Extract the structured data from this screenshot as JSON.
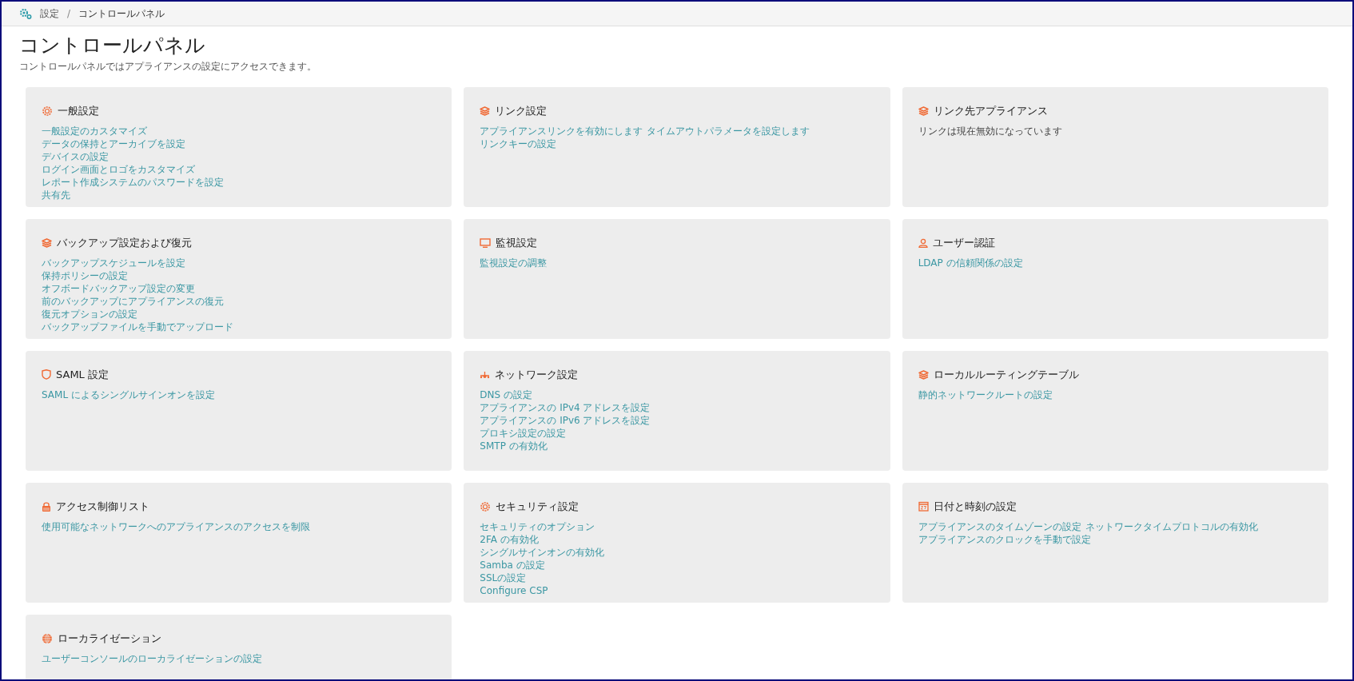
{
  "breadcrumb": [
    {
      "label": "設定",
      "kind": "link"
    },
    {
      "label": "/",
      "kind": "separator"
    },
    {
      "label": "コントロールパネル",
      "kind": "current"
    }
  ],
  "page": {
    "title": "コントロールパネル",
    "subtitle": "コントロールパネルではアプライアンスの設定にアクセスできます。"
  },
  "cards": [
    {
      "title": "一般設定",
      "items": [
        {
          "kind": "link",
          "label": "一般設定のカスタマイズ"
        },
        {
          "kind": "link",
          "label": "データの保持とアーカイブを設定"
        },
        {
          "kind": "link",
          "label": "デバイスの設定"
        },
        {
          "kind": "link",
          "label": "ログイン画面とロゴをカスタマイズ"
        },
        {
          "kind": "link",
          "label": "レポート作成システムのパスワードを設定"
        },
        {
          "kind": "link",
          "label": "共有先"
        }
      ]
    },
    {
      "title": "リンク設定",
      "items": [
        {
          "kind": "inline_link",
          "label": "アプライアンスリンクを有効にします"
        },
        {
          "kind": "inline_link",
          "label": "タイムアウトパラメータを設定します"
        },
        {
          "kind": "inline_link",
          "label": "リンクキーの設定"
        }
      ]
    },
    {
      "title": "リンク先アプライアンス",
      "items": [
        {
          "kind": "text",
          "label": "リンクは現在無効になっています"
        }
      ]
    },
    {
      "title": "バックアップ設定および復元",
      "items": [
        {
          "kind": "link",
          "label": "バックアップスケジュールを設定"
        },
        {
          "kind": "link",
          "label": "保持ポリシーの設定"
        },
        {
          "kind": "link",
          "label": "オフボードバックアップ設定の変更"
        },
        {
          "kind": "link",
          "label": "前のバックアップにアプライアンスの復元"
        },
        {
          "kind": "link",
          "label": "復元オプションの設定"
        },
        {
          "kind": "link",
          "label": "バックアップファイルを手動でアップロード"
        }
      ]
    },
    {
      "title": "監視設定",
      "items": [
        {
          "kind": "link",
          "label": "監視設定の調整"
        }
      ]
    },
    {
      "title": "ユーザー認証",
      "items": [
        {
          "kind": "link",
          "label": "LDAP の信頼関係の設定"
        }
      ]
    },
    {
      "title": "SAML 設定",
      "items": [
        {
          "kind": "link",
          "label": "SAML によるシングルサインオンを設定"
        }
      ]
    },
    {
      "title": "ネットワーク設定",
      "items": [
        {
          "kind": "link",
          "label": "DNS の設定"
        },
        {
          "kind": "link",
          "label": "アプライアンスの IPv4 アドレスを設定"
        },
        {
          "kind": "link",
          "label": "アプライアンスの IPv6 アドレスを設定"
        },
        {
          "kind": "link",
          "label": "プロキシ設定の設定"
        },
        {
          "kind": "link",
          "label": "SMTP の有効化"
        }
      ]
    },
    {
      "title": "ローカルルーティングテーブル",
      "items": [
        {
          "kind": "link",
          "label": "静的ネットワークルートの設定"
        }
      ]
    },
    {
      "title": "アクセス制御リスト",
      "items": [
        {
          "kind": "link",
          "label": "使用可能なネットワークへのアプライアンスのアクセスを制限"
        }
      ]
    },
    {
      "title": "セキュリティ設定",
      "items": [
        {
          "kind": "link",
          "label": "セキュリティのオプション"
        },
        {
          "kind": "link",
          "label": "2FA の有効化"
        },
        {
          "kind": "link",
          "label": "シングルサインオンの有効化"
        },
        {
          "kind": "link",
          "label": "Samba の設定"
        },
        {
          "kind": "link",
          "label": "SSLの設定"
        },
        {
          "kind": "link",
          "label": "Configure CSP"
        }
      ]
    },
    {
      "title": "日付と時刻の設定",
      "items": [
        {
          "kind": "inline_link",
          "label": "アプライアンスのタイムゾーンの設定"
        },
        {
          "kind": "inline_link",
          "label": "ネットワークタイムプロトコルの有効化"
        },
        {
          "kind": "inline_link",
          "label": "アプライアンスのクロックを手動で設定"
        }
      ]
    },
    {
      "title": "ローカライゼーション",
      "items": [
        {
          "kind": "link",
          "label": "ユーザーコンソールのローカライゼーションの設定"
        }
      ]
    }
  ]
}
